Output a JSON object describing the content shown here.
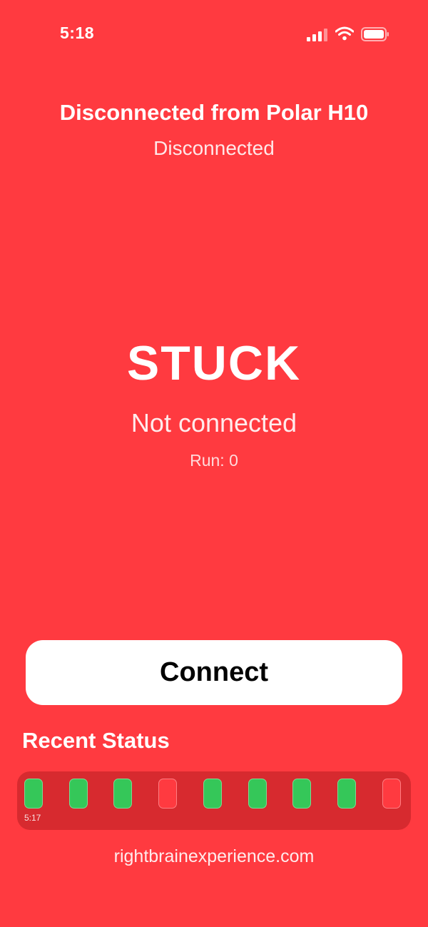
{
  "status_bar": {
    "time": "5:18",
    "icons": [
      "cellular-signal-icon",
      "wifi-icon",
      "battery-icon"
    ]
  },
  "device": {
    "title": "Disconnected from Polar H10",
    "subtitle": "Disconnected"
  },
  "state": {
    "label": "STUCK",
    "detail": "Not connected",
    "run": "Run: 0"
  },
  "connect_button": {
    "label": "Connect"
  },
  "recent_status": {
    "heading": "Recent Status",
    "start_time": "5:17",
    "cells": [
      "ok",
      "ok",
      "ok",
      "bad",
      "ok",
      "ok",
      "ok",
      "ok",
      "bad"
    ]
  },
  "footer": {
    "link": "rightbrainexperience.com"
  },
  "colors": {
    "background": "#ff3a40",
    "strip": "#d72a2f",
    "ok": "#35c759",
    "button": "#ffffff"
  }
}
